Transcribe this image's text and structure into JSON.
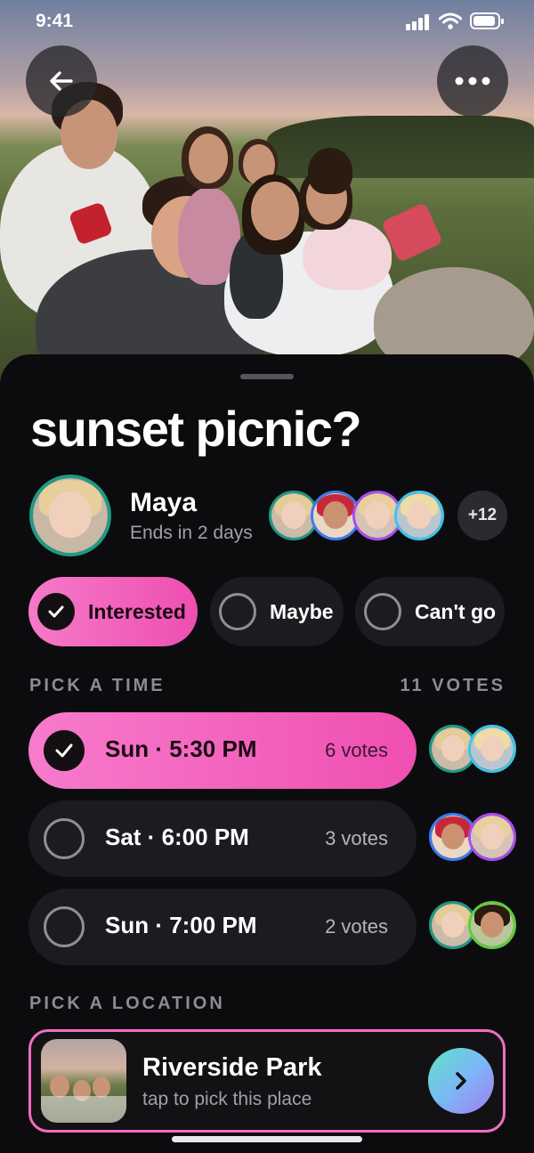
{
  "status_bar": {
    "time": "9:41"
  },
  "event": {
    "title": "sunset picnic?",
    "host_name": "Maya",
    "ends_text": "Ends in 2 days",
    "extra_attendees": "+12"
  },
  "rsvp": [
    {
      "label": "Interested",
      "selected": true
    },
    {
      "label": "Maybe",
      "selected": false
    },
    {
      "label": "Can't go",
      "selected": false
    }
  ],
  "time_section": {
    "label": "PICK A TIME",
    "total_votes": "11 VOTES",
    "options": [
      {
        "label": "Sun · 5:30 PM",
        "votes": "6 votes",
        "selected": true
      },
      {
        "label": "Sat · 6:00 PM",
        "votes": "3 votes",
        "selected": false
      },
      {
        "label": "Sun · 7:00 PM",
        "votes": "2 votes",
        "selected": false
      }
    ]
  },
  "location_section": {
    "label": "PICK A LOCATION",
    "place_name": "Riverside Park",
    "place_hint": "tap to pick this place"
  },
  "colors": {
    "accent_pink": "#f06ec0",
    "ring_teal": "#1f9a86",
    "ring_blue": "#3a7bf0",
    "ring_purple": "#a84df0",
    "ring_cyan": "#3fc4ea",
    "ring_green": "#5bd03a"
  },
  "icons": [
    "back-arrow-icon",
    "more-dots-icon",
    "check-icon",
    "chevron-right-icon",
    "signal-icon",
    "wifi-icon",
    "battery-icon"
  ]
}
